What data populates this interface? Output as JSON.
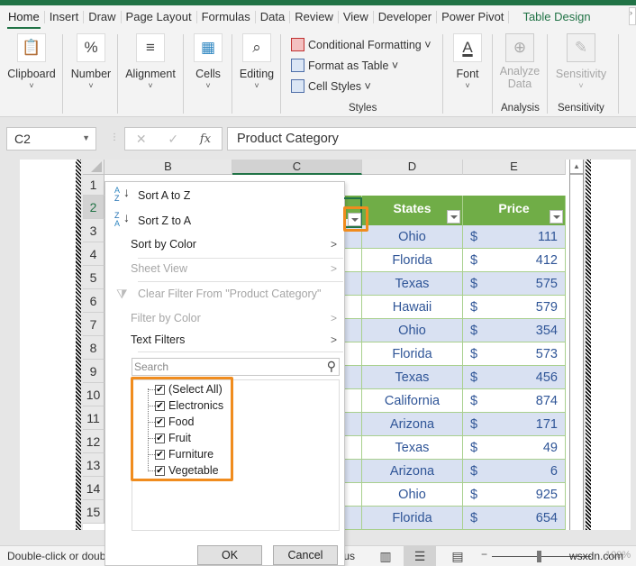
{
  "ribbon": {
    "tabs": [
      "Home",
      "Insert",
      "Draw",
      "Page Layout",
      "Formulas",
      "Data",
      "Review",
      "View",
      "Developer",
      "Power Pivot"
    ],
    "context_tab": "Table Design",
    "active_tab": "Home",
    "groups": {
      "clipboard": "Clipboard",
      "number": "Number",
      "alignment": "Alignment",
      "cells": "Cells",
      "editing": "Editing",
      "font": "Font",
      "analyze_data_line1": "Analyze",
      "analyze_data_line2": "Data",
      "sensitivity": "Sensitivity"
    },
    "styles_items": [
      "Conditional Formatting ˅",
      "Format as Table ˅",
      "Cell Styles ˅"
    ],
    "captions": {
      "styles": "Styles",
      "analysis": "Analysis",
      "sensitivity": "Sensitivity"
    },
    "accent_color": "#217346"
  },
  "formula_bar": {
    "name_box": "C2",
    "cancel_icon": "✕",
    "enter_icon": "✓",
    "fx_label": "fx",
    "content": "Product Category"
  },
  "sheet": {
    "columns": [
      "B",
      "C",
      "D",
      "E"
    ],
    "selected_column": "C",
    "rows": [
      "1",
      "2",
      "3",
      "4",
      "5",
      "6",
      "7",
      "8",
      "9",
      "10",
      "11",
      "12",
      "13",
      "14",
      "15"
    ],
    "selected_row": "2",
    "table_header": {
      "states": "States",
      "price": "Price"
    },
    "currency_symbol": "$",
    "data": [
      {
        "state": "Ohio",
        "price": "111"
      },
      {
        "state": "Florida",
        "price": "412"
      },
      {
        "state": "Texas",
        "price": "575"
      },
      {
        "state": "Hawaii",
        "price": "579"
      },
      {
        "state": "Ohio",
        "price": "354"
      },
      {
        "state": "Florida",
        "price": "573"
      },
      {
        "state": "Texas",
        "price": "456"
      },
      {
        "state": "California",
        "price": "874"
      },
      {
        "state": "Arizona",
        "price": "171"
      },
      {
        "state": "Texas",
        "price": "49"
      },
      {
        "state": "Arizona",
        "price": "6"
      },
      {
        "state": "Ohio",
        "price": "925"
      },
      {
        "state": "Florida",
        "price": "654"
      }
    ],
    "header_color": "#70ad47",
    "band_color": "#d9e1f2",
    "highlight_color": "#f08c1e"
  },
  "filter_menu": {
    "sort_az": "Sort A to Z",
    "sort_za": "Sort Z to A",
    "sort_by_color": "Sort by Color",
    "sheet_view": "Sheet View",
    "clear_filter": "Clear Filter From \"Product Category\"",
    "filter_by_color": "Filter by Color",
    "text_filters": "Text Filters",
    "search_placeholder": "Search",
    "items": [
      {
        "label": "(Select All)",
        "checked": true
      },
      {
        "label": "Electronics",
        "checked": true
      },
      {
        "label": "Food",
        "checked": true
      },
      {
        "label": "Fruit",
        "checked": true
      },
      {
        "label": "Furniture",
        "checked": true
      },
      {
        "label": "Vegetable",
        "checked": true
      }
    ],
    "ok": "OK",
    "cancel": "Cancel"
  },
  "status_bar": {
    "message": "Double-click or doub",
    "partial": "tus",
    "watermark": "wsxdn.com",
    "zoom": "100%"
  }
}
